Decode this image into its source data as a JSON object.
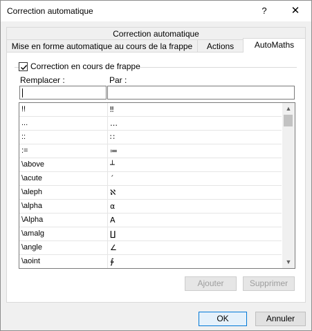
{
  "window": {
    "title": "Correction automatique",
    "help_label": "?",
    "close_label": "✕"
  },
  "tabs": {
    "row1": "Correction automatique",
    "row2": [
      "Mise en forme automatique au cours de la frappe",
      "Actions",
      "AutoMaths"
    ],
    "active": "AutoMaths"
  },
  "group": {
    "checkbox_label": "Correction en cours de frappe",
    "checked": true
  },
  "fields": {
    "replace_label": "Remplacer :",
    "by_label": "Par :",
    "replace_value": "",
    "by_value": ""
  },
  "list": {
    "rows": [
      {
        "from": "!!",
        "to": "‼"
      },
      {
        "from": "...",
        "to": "…"
      },
      {
        "from": "::",
        "to": "∷"
      },
      {
        "from": ":=",
        "to": "≔"
      },
      {
        "from": "\\above",
        "to": "┴"
      },
      {
        "from": "\\acute",
        "to": "´"
      },
      {
        "from": "\\aleph",
        "to": "ℵ"
      },
      {
        "from": "\\alpha",
        "to": "α"
      },
      {
        "from": "\\Alpha",
        "to": "Α"
      },
      {
        "from": "\\amalg",
        "to": "∐"
      },
      {
        "from": "\\angle",
        "to": "∠"
      },
      {
        "from": "\\aoint",
        "to": "∳"
      }
    ]
  },
  "buttons": {
    "add": "Ajouter",
    "delete": "Supprimer",
    "ok": "OK",
    "cancel": "Annuler"
  }
}
